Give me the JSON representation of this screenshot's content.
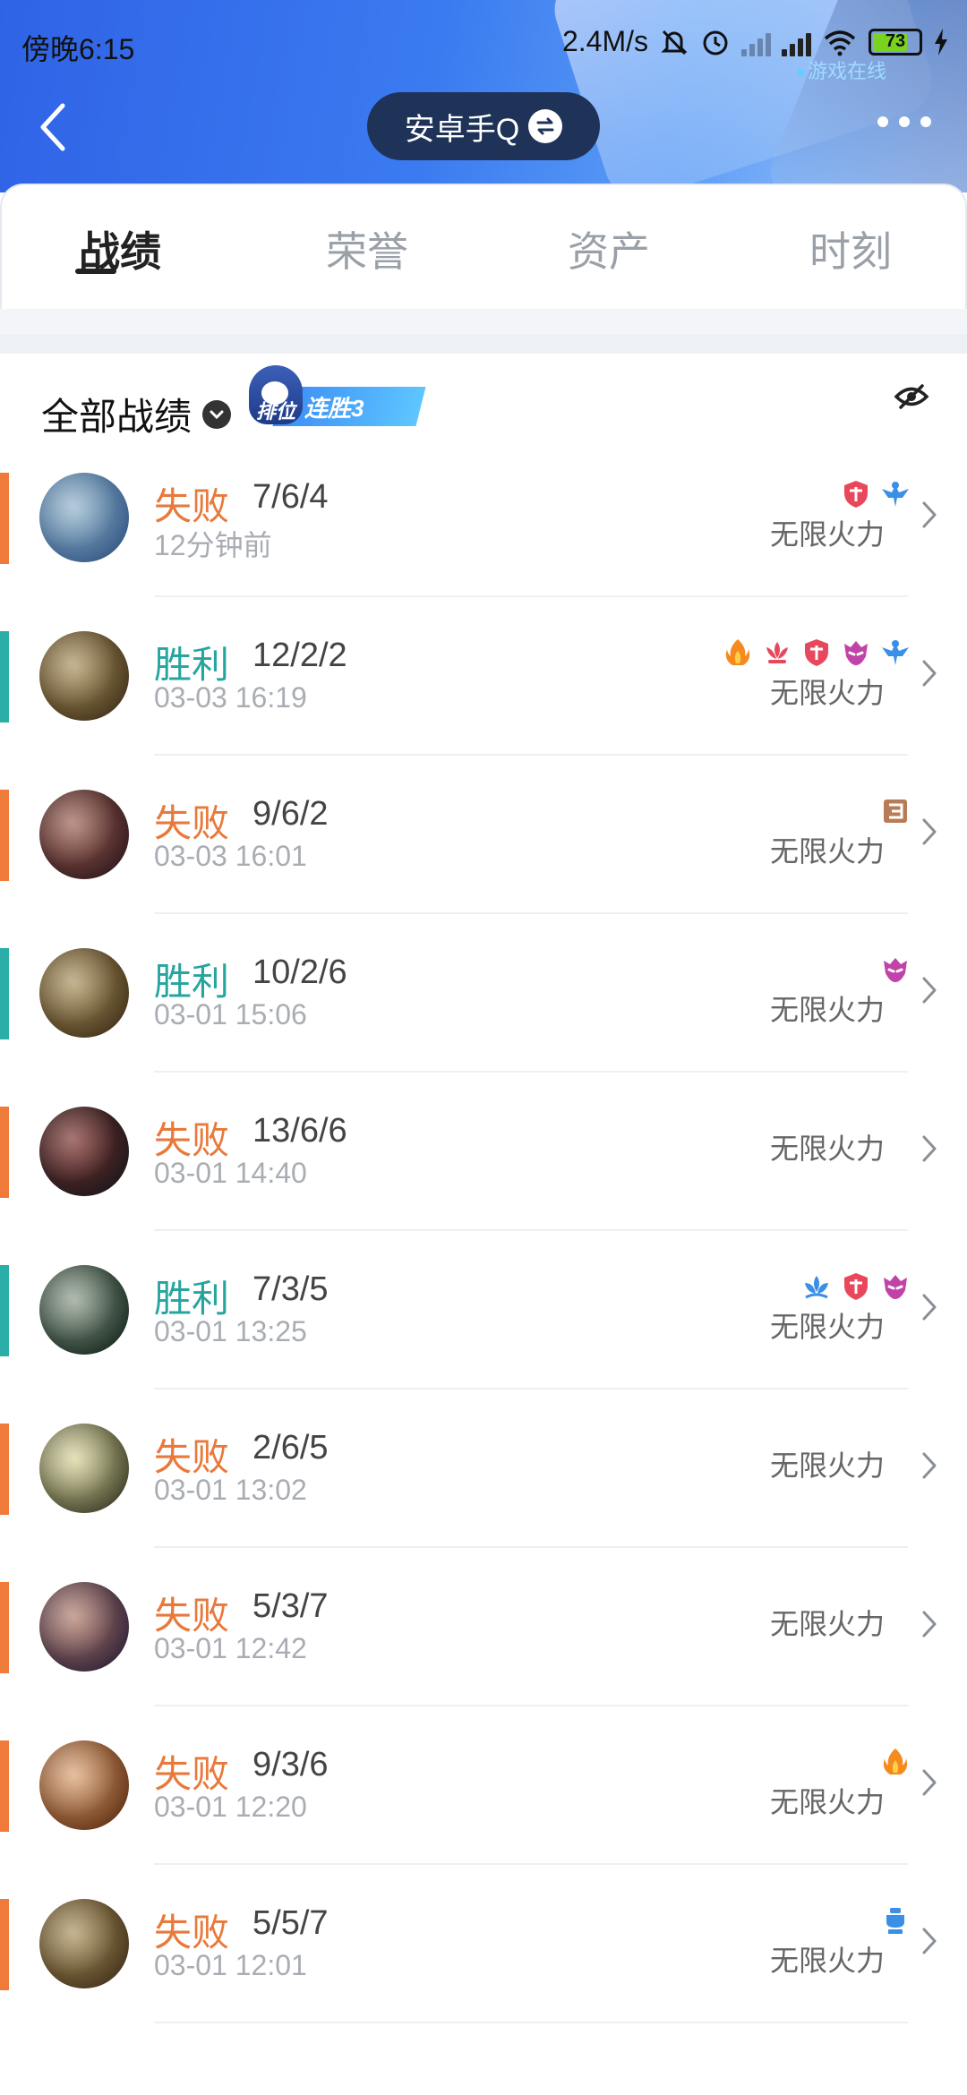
{
  "status_bar": {
    "time": "傍晚6:15",
    "network_speed": "2.4M/s",
    "battery": "73",
    "online_status": "游戏在线"
  },
  "header": {
    "account_label": "安卓手Q"
  },
  "tabs": [
    {
      "label": "战绩",
      "active": true
    },
    {
      "label": "荣誉",
      "active": false
    },
    {
      "label": "资产",
      "active": false
    },
    {
      "label": "时刻",
      "active": false
    }
  ],
  "section": {
    "title": "全部战绩",
    "streak_rank_label": "排位",
    "streak_label": "连胜3"
  },
  "matches": [
    {
      "result": "失败",
      "outcome": "loss",
      "kda": "7/6/4",
      "time": "12分钟前",
      "mode": "无限火力",
      "medals": [
        "red-shield-medal-icon",
        "blue-wing-medal-icon"
      ],
      "avatar_colors": [
        "#3b5f8a",
        "#8fb3c9"
      ]
    },
    {
      "result": "胜利",
      "outcome": "win",
      "kda": "12/2/2",
      "time": "03-03 16:19",
      "mode": "无限火力",
      "medals": [
        "orange-flame-medal-icon",
        "red-lotus-medal-icon",
        "red-shield-medal-icon",
        "purple-mask-medal-icon",
        "blue-wing-medal-icon"
      ],
      "avatar_colors": [
        "#4b3a20",
        "#a9905a"
      ]
    },
    {
      "result": "失败",
      "outcome": "loss",
      "kda": "9/6/2",
      "time": "03-03 16:01",
      "mode": "无限火力",
      "medals": [
        "bronze-three-medal-icon"
      ],
      "avatar_colors": [
        "#3a1f22",
        "#9b5d4e"
      ]
    },
    {
      "result": "胜利",
      "outcome": "win",
      "kda": "10/2/6",
      "time": "03-01 15:06",
      "mode": "无限火力",
      "medals": [
        "purple-mask-medal-icon"
      ],
      "avatar_colors": [
        "#4b3a20",
        "#a9905a"
      ]
    },
    {
      "result": "失败",
      "outcome": "loss",
      "kda": "13/6/6",
      "time": "03-01 14:40",
      "mode": "无限火力",
      "medals": [],
      "avatar_colors": [
        "#221a1d",
        "#7a2f2a"
      ]
    },
    {
      "result": "胜利",
      "outcome": "win",
      "kda": "7/3/5",
      "time": "03-01 13:25",
      "mode": "无限火力",
      "medals": [
        "blue-lotus-medal-icon",
        "red-shield-medal-icon",
        "purple-mask-medal-icon"
      ],
      "avatar_colors": [
        "#223329",
        "#8a9a88"
      ]
    },
    {
      "result": "失败",
      "outcome": "loss",
      "kda": "2/6/5",
      "time": "03-01 13:02",
      "mode": "无限火力",
      "medals": [],
      "avatar_colors": [
        "#4a4a32",
        "#d8d49a"
      ]
    },
    {
      "result": "失败",
      "outcome": "loss",
      "kda": "5/3/7",
      "time": "03-01 12:42",
      "mode": "无限火力",
      "medals": [],
      "avatar_colors": [
        "#3a2a3d",
        "#b07a6a"
      ]
    },
    {
      "result": "失败",
      "outcome": "loss",
      "kda": "9/3/6",
      "time": "03-01 12:20",
      "mode": "无限火力",
      "medals": [
        "orange-flame-medal-icon"
      ],
      "avatar_colors": [
        "#6b3b1d",
        "#d9a070"
      ]
    },
    {
      "result": "失败",
      "outcome": "loss",
      "kda": "5/5/7",
      "time": "03-01 12:01",
      "mode": "无限火力",
      "medals": [
        "blue-trophy-medal-icon"
      ],
      "avatar_colors": [
        "#4b3a20",
        "#a9905a"
      ]
    }
  ],
  "colors": {
    "loss": "#e9793b",
    "win": "#26a59e",
    "header_gradient_start": "#2f63e6",
    "account_pill": "#1f3358"
  }
}
